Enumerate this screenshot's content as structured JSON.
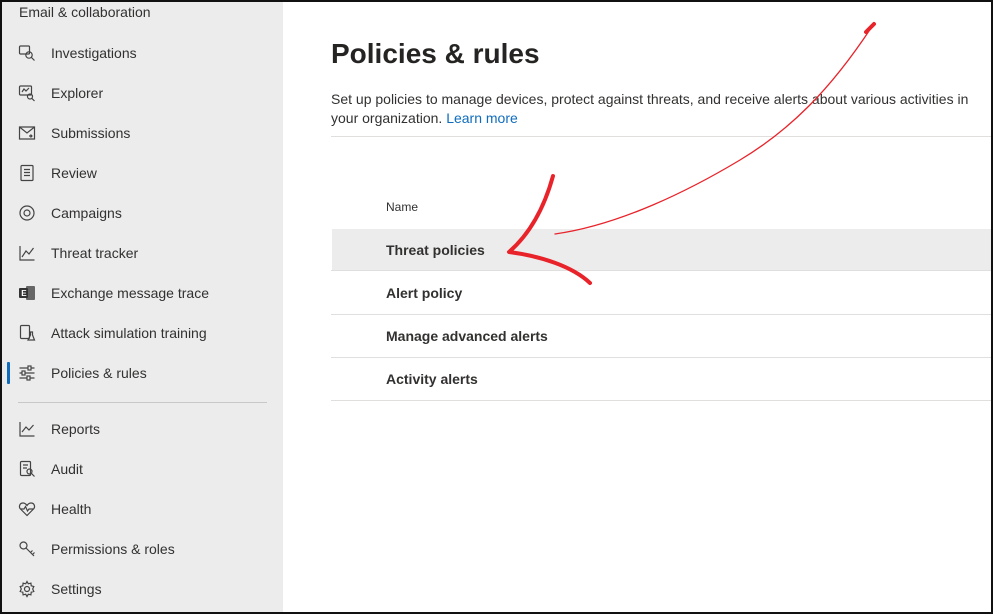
{
  "sidebar": {
    "section_title": "Email & collaboration",
    "items": [
      {
        "label": "Investigations",
        "icon": "investigations-icon"
      },
      {
        "label": "Explorer",
        "icon": "explorer-icon"
      },
      {
        "label": "Submissions",
        "icon": "submissions-icon"
      },
      {
        "label": "Review",
        "icon": "review-icon"
      },
      {
        "label": "Campaigns",
        "icon": "campaigns-icon"
      },
      {
        "label": "Threat tracker",
        "icon": "threat-tracker-icon"
      },
      {
        "label": "Exchange message trace",
        "icon": "exchange-icon"
      },
      {
        "label": "Attack simulation training",
        "icon": "flask-icon"
      },
      {
        "label": "Policies & rules",
        "icon": "sliders-icon",
        "active": true
      },
      {
        "label": "Reports",
        "icon": "chart-icon"
      },
      {
        "label": "Audit",
        "icon": "audit-icon"
      },
      {
        "label": "Health",
        "icon": "heart-icon"
      },
      {
        "label": "Permissions & roles",
        "icon": "key-icon"
      },
      {
        "label": "Settings",
        "icon": "gear-icon"
      }
    ]
  },
  "main": {
    "title": "Policies & rules",
    "description": "Set up policies to manage devices, protect against threats, and receive alerts about various activities in your organization.",
    "learn_more": "Learn more",
    "column_header": "Name",
    "rows": [
      {
        "label": "Threat policies",
        "selected": true
      },
      {
        "label": "Alert policy"
      },
      {
        "label": "Manage advanced alerts"
      },
      {
        "label": "Activity alerts"
      }
    ]
  },
  "colors": {
    "accent": "#0f6cbd",
    "sidebar_bg": "#ececec",
    "annotation": "#e8232a"
  }
}
